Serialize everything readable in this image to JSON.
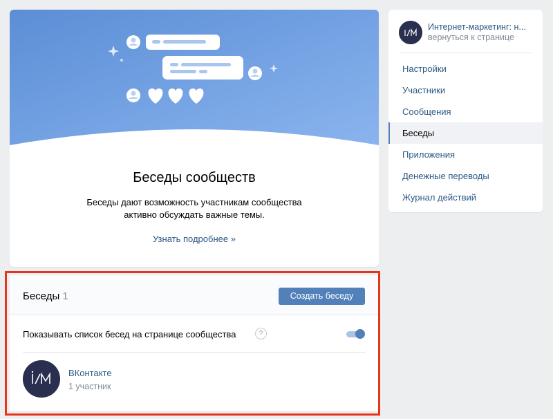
{
  "hero": {
    "title": "Беседы сообществ",
    "description": "Беседы дают возможность участникам сообщества активно обсуждать важные темы.",
    "link": "Узнать подробнее »"
  },
  "conversations": {
    "title": "Беседы",
    "count": "1",
    "create_button": "Создать беседу",
    "show_list_label": "Показывать список бесед на странице сообщества",
    "help_label": "?",
    "show_list_enabled": true,
    "items": [
      {
        "name": "ВКонтакте",
        "members": "1 участник",
        "avatar_icon": "im-logo-icon"
      }
    ]
  },
  "sidebar": {
    "group_name": "Интернет-маркетинг: н...",
    "back_link": "вернуться к странице",
    "items": [
      {
        "label": "Настройки",
        "active": false
      },
      {
        "label": "Участники",
        "active": false
      },
      {
        "label": "Сообщения",
        "active": false
      },
      {
        "label": "Беседы",
        "active": true
      },
      {
        "label": "Приложения",
        "active": false
      },
      {
        "label": "Денежные переводы",
        "active": false
      },
      {
        "label": "Журнал действий",
        "active": false
      }
    ]
  },
  "colors": {
    "accent": "#5181b8",
    "link": "#2a5885",
    "highlight_frame": "#e9341c",
    "banner_top": "#5e8fd6",
    "banner_bottom": "#87b1ec"
  }
}
